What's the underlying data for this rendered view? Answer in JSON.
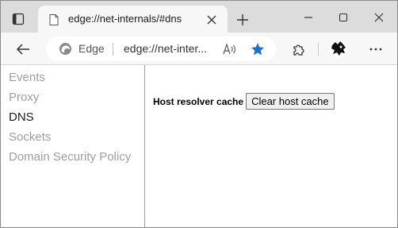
{
  "tab": {
    "title": "edge://net-internals/#dns"
  },
  "toolbar": {
    "site_identity_label": "Edge",
    "url": "edge://net-inter..."
  },
  "sidebar": {
    "items": [
      {
        "label": "Events"
      },
      {
        "label": "Proxy"
      },
      {
        "label": "DNS"
      },
      {
        "label": "Sockets"
      },
      {
        "label": "Domain Security Policy"
      }
    ],
    "active_index": 2
  },
  "dns": {
    "host_resolver_label": "Host resolver cache",
    "clear_button_label": "Clear host cache"
  },
  "colors": {
    "tabstrip_bg": "#dcdcdc",
    "toolbar_bg": "#f7f7f7",
    "favorite_star": "#1a73c9",
    "inactive_nav": "#9e9e9e"
  }
}
